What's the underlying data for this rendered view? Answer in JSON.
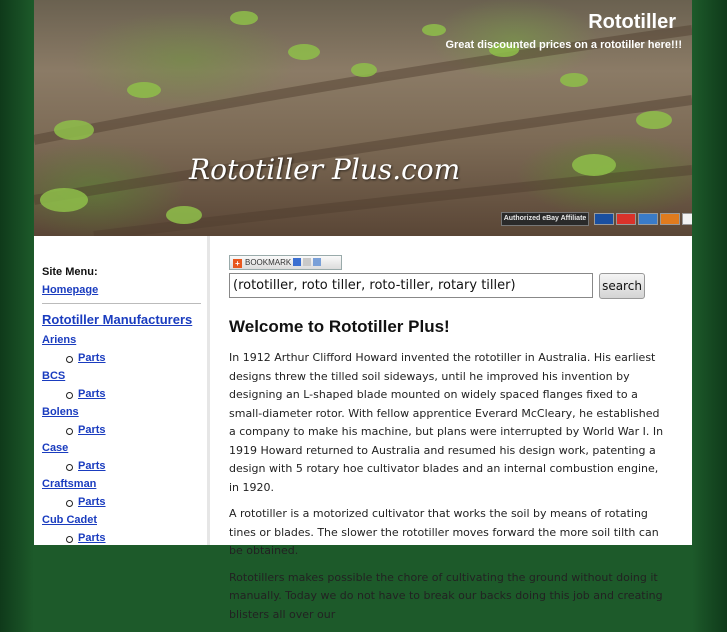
{
  "header": {
    "site_title": "Rototiller",
    "tagline": "Great discounted prices on a rototiller here!!!",
    "logo_text": "Rototiller Plus.com",
    "affiliate_badge": "Authorized eBay Affiliate",
    "payment_icons": [
      "visa-icon",
      "mastercard-icon",
      "amex-icon",
      "discover-icon",
      "paypal-icon"
    ]
  },
  "sidebar": {
    "title": "Site Menu:",
    "home_link": "Homepage",
    "manufacturers_heading": "Rototiller Manufacturers",
    "brands": [
      {
        "name": "Ariens",
        "sub": "Parts"
      },
      {
        "name": "BCS",
        "sub": "Parts"
      },
      {
        "name": "Bolens",
        "sub": "Parts"
      },
      {
        "name": "Case",
        "sub": "Parts"
      },
      {
        "name": "Craftsman",
        "sub": "Parts"
      },
      {
        "name": "Cub Cadet",
        "sub": "Parts"
      }
    ]
  },
  "main": {
    "bookmark_label": "BOOKMARK",
    "search_value": "(rototiller, roto tiller, roto-tiller, rotary tiller)",
    "search_button": "search",
    "heading": "Welcome to Rototiller Plus!",
    "paragraphs": [
      "In 1912 Arthur Clifford Howard invented the rototiller in Australia.  His earliest designs threw the tilled soil sideways, until he improved his invention by designing an L-shaped blade mounted on widely spaced flanges fixed to a small-diameter rotor. With fellow apprentice Everard McCleary, he established a company to make his machine, but plans were interrupted by World War I. In 1919 Howard returned to Australia and resumed his design work, patenting a design with 5 rotary hoe cultivator blades and an internal combustion engine, in 1920.",
      "A  rototiller is a motorized cultivator that works the soil by means of rotating tines or blades.  The slower the rototiller moves forward the more soil tilth can be obtained.",
      "Rototillers makes possible the chore of cultivating the ground without doing it manually. Today we do not have to break our backs doing this job and creating blisters all over our"
    ]
  },
  "colors": {
    "page_bg": "#1d5a2a",
    "link": "#1a3cbf",
    "text": "#222222"
  }
}
